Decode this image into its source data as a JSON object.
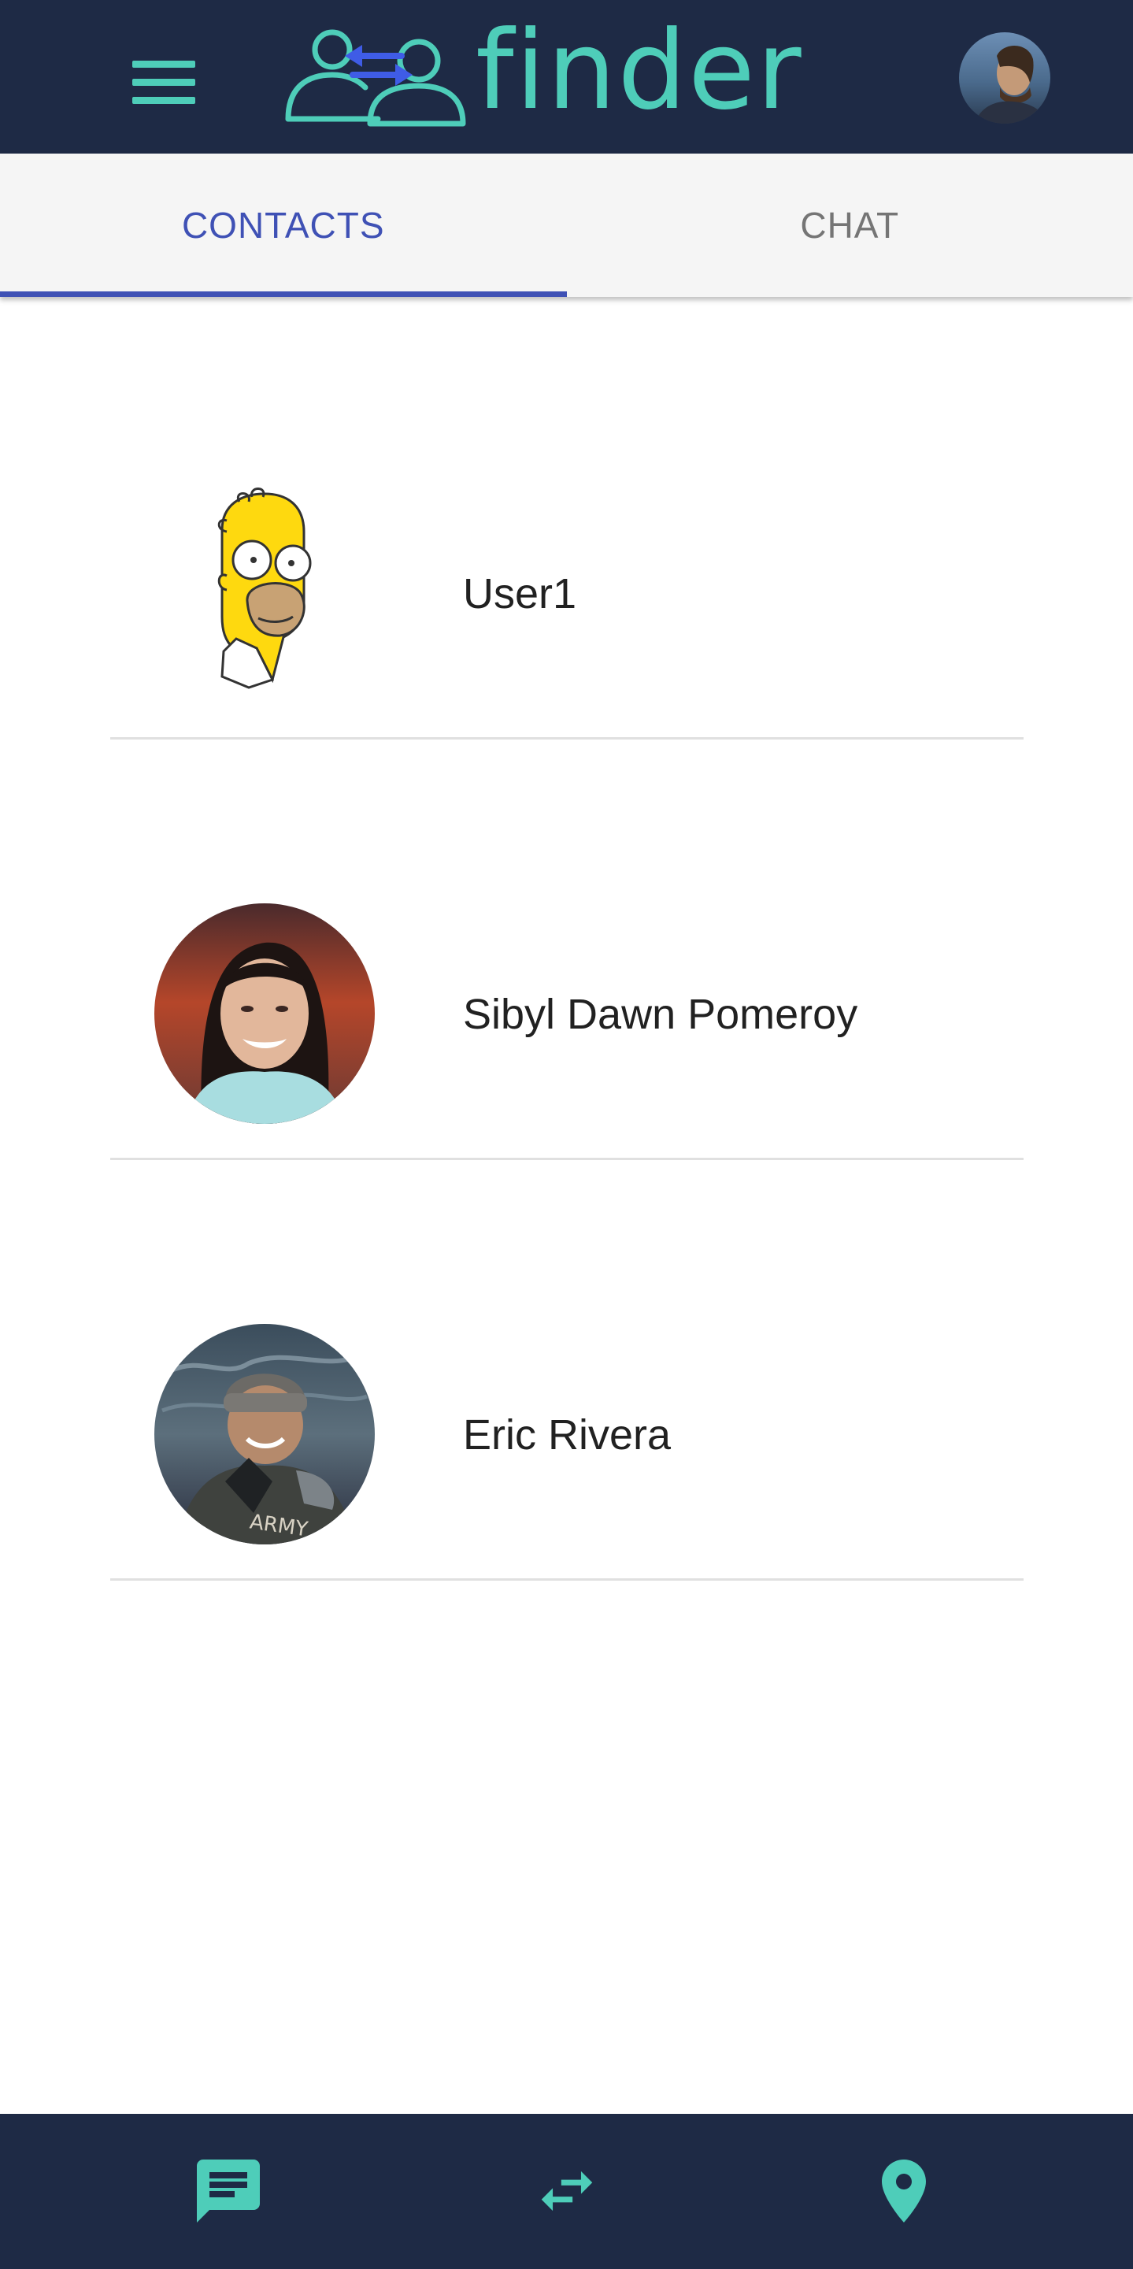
{
  "header": {
    "app_name": "finder",
    "menu_icon": "menu-icon",
    "avatar_icon": "profile-avatar"
  },
  "tabs": [
    {
      "label": "CONTACTS",
      "active": true
    },
    {
      "label": "CHAT",
      "active": false
    }
  ],
  "contacts": [
    {
      "name": "User1",
      "avatar": "cartoon-avatar"
    },
    {
      "name": "Sibyl Dawn Pomeroy",
      "avatar": "photo-avatar"
    },
    {
      "name": "Eric Rivera",
      "avatar": "photo-avatar"
    }
  ],
  "bottom_nav": [
    {
      "icon": "chat-icon"
    },
    {
      "icon": "swap-icon"
    },
    {
      "icon": "location-pin-icon"
    }
  ],
  "colors": {
    "app_bar": "#1e2a45",
    "accent_teal": "#4ecdb9",
    "tab_active": "#3f51b5",
    "tab_inactive": "#757575",
    "divider": "#e0e0e0"
  }
}
